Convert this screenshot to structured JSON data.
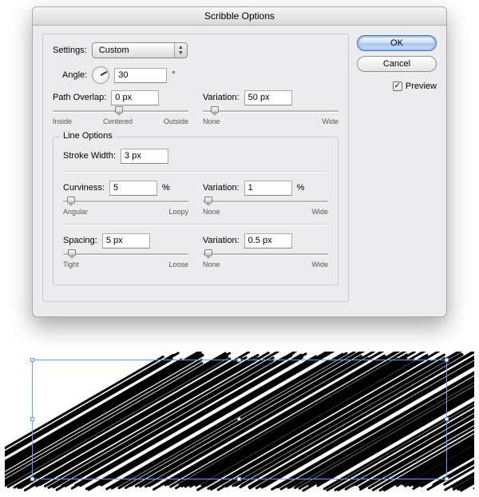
{
  "dialog": {
    "title": "Scribble Options",
    "settings_label": "Settings:",
    "settings_value": "Custom",
    "angle_label": "Angle:",
    "angle_value": "30",
    "angle_unit": "°",
    "path_overlap_label": "Path Overlap:",
    "path_overlap_value": "0 px",
    "overlap_slider": {
      "left": "Inside",
      "center": "Centered",
      "right": "Outside",
      "pos": 50
    },
    "variation1_label": "Variation:",
    "variation1_value": "50 px",
    "variation1_slider": {
      "left": "None",
      "right": "Wide",
      "pos": 8
    },
    "line_options_legend": "Line Options",
    "stroke_width_label": "Stroke Width:",
    "stroke_width_value": "3 px",
    "curviness_label": "Curviness:",
    "curviness_value": "5",
    "curviness_unit": "%",
    "curviness_slider": {
      "left": "Angular",
      "right": "Loopy",
      "pos": 5
    },
    "variation2_label": "Variation:",
    "variation2_value": "1",
    "variation2_unit": "%",
    "variation2_slider": {
      "left": "None",
      "right": "Wide",
      "pos": 3
    },
    "spacing_label": "Spacing:",
    "spacing_value": "5 px",
    "spacing_slider": {
      "left": "Tight",
      "right": "Loose",
      "pos": 6
    },
    "variation3_label": "Variation:",
    "variation3_value": "0.5 px",
    "variation3_slider": {
      "left": "None",
      "right": "Wide",
      "pos": 3
    }
  },
  "buttons": {
    "ok": "OK",
    "cancel": "Cancel",
    "preview_label": "Preview",
    "preview_checked": true
  }
}
